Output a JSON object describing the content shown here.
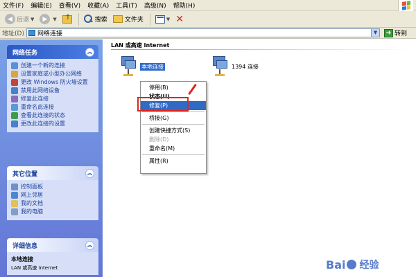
{
  "menubar": {
    "items": [
      "文件(F)",
      "编辑(E)",
      "查看(V)",
      "收藏(A)",
      "工具(T)",
      "高级(N)",
      "帮助(H)"
    ]
  },
  "toolbar": {
    "back_label": "后退",
    "search_label": "搜索",
    "folders_label": "文件夹"
  },
  "address": {
    "label": "地址(D)",
    "value": "网络连接",
    "go_label": "转到"
  },
  "left_pane": {
    "network_tasks": {
      "title": "网络任务",
      "items": [
        "创建一个新的连接",
        "设置家庭或小型办公网络",
        "更改 Windows 防火墙设置",
        "禁用此网络设备",
        "修复此连接",
        "重命名此连接",
        "查看此连接的状态",
        "更改此连接的设置"
      ]
    },
    "other_places": {
      "title": "其它位置",
      "items": [
        "控制面板",
        "网上邻居",
        "我的文档",
        "我的电脑"
      ]
    },
    "details": {
      "title": "详细信息",
      "name": "本地连接",
      "sub": "LAN 或高速 Internet"
    }
  },
  "main": {
    "group_header": "LAN 或高速 Internet",
    "connections": [
      {
        "label": "本地连接",
        "selected": true
      },
      {
        "label": "1394 连接",
        "selected": false
      }
    ]
  },
  "context_menu": {
    "items": [
      {
        "label": "停用(B)",
        "style": "normal"
      },
      {
        "label": "状态(U)",
        "style": "bold"
      },
      {
        "label": "修复(P)",
        "style": "highlight"
      },
      {
        "label": "桥接(G)",
        "style": "normal"
      },
      {
        "label": "创建快捷方式(S)",
        "style": "normal"
      },
      {
        "label": "删除(D)",
        "style": "disabled"
      },
      {
        "label": "重命名(M)",
        "style": "normal"
      },
      {
        "label": "属性(R)",
        "style": "normal"
      }
    ]
  },
  "watermark": {
    "text": "Bai",
    "text2": "经验"
  },
  "colors": {
    "selection": "#316ac5",
    "annotation_red": "#e0241c",
    "pane_blue": "#6375d6"
  }
}
